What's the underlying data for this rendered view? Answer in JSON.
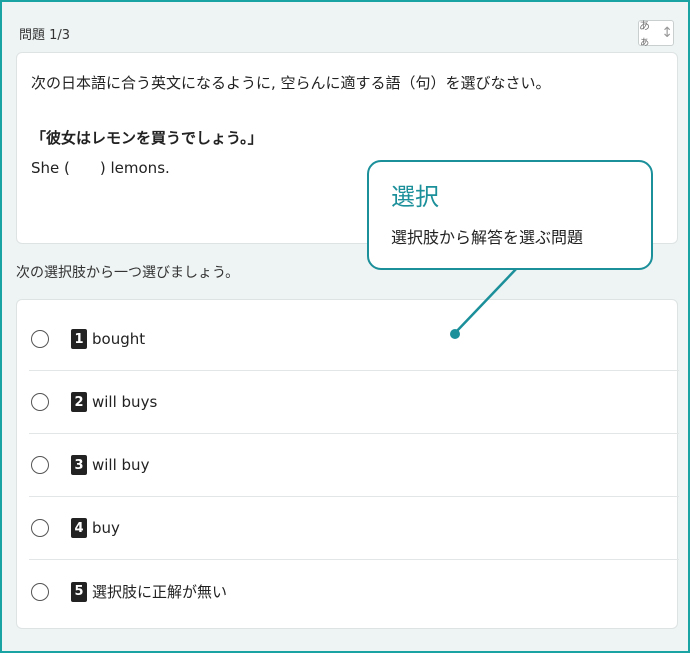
{
  "header": {
    "progress_label": "問題 1/3"
  },
  "font_toggle": {
    "label": "あぁ",
    "icon": "resize-vertical-icon"
  },
  "question": {
    "instruction": "次の日本語に合う英文になるように, 空らんに適する語（句）を選びなさい。",
    "japanese": "「彼女はレモンを買うでしょう。」",
    "english": "She (　　) lemons."
  },
  "prompt": "次の選択肢から一つ選びましょう。",
  "choices": [
    {
      "number": "1",
      "text": "bought"
    },
    {
      "number": "2",
      "text": "will buys"
    },
    {
      "number": "3",
      "text": "will buy"
    },
    {
      "number": "4",
      "text": "buy"
    },
    {
      "number": "5",
      "text": "選択肢に正解が無い"
    }
  ],
  "callout": {
    "title": "選択",
    "description": "選択肢から解答を選ぶ問題"
  },
  "colors": {
    "accent": "#1b8f9a",
    "frame": "#1aa3a3",
    "background": "#eef3f3"
  }
}
